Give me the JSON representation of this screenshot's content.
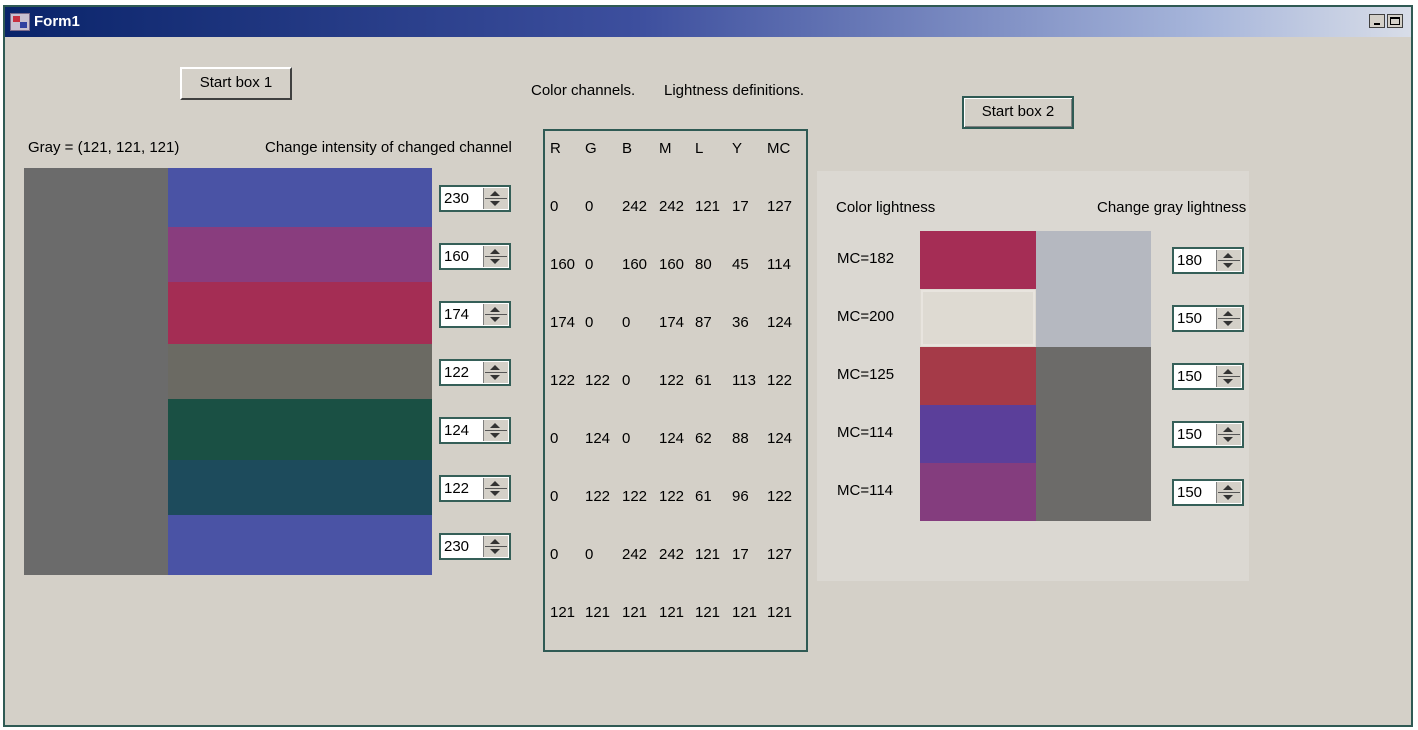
{
  "window": {
    "title": "Form1",
    "controls": {
      "minimize": "minimize-icon",
      "maximize": "maximize-icon"
    }
  },
  "left": {
    "start_button": "Start box 1",
    "gray_label": "Gray = (121, 121, 121)",
    "change_label": "Change intensity of changed channel",
    "gray_color": "#6b6b6b",
    "swatches": [
      {
        "color": "#4a53a5",
        "value": "230"
      },
      {
        "color": "#893d7e",
        "value": "160"
      },
      {
        "color": "#a42d54",
        "value": "174"
      },
      {
        "color": "#6b6a63",
        "value": "122"
      },
      {
        "color": "#1a5044",
        "value": "124"
      },
      {
        "color": "#1d4b5c",
        "value": "122"
      },
      {
        "color": "#4a53a5",
        "value": "230"
      }
    ]
  },
  "middle": {
    "channels_label": "Color channels.",
    "lightness_label": "Lightness definitions.",
    "headers": [
      "R",
      "G",
      "B",
      "M",
      "L",
      "Y",
      "MC"
    ],
    "rows": [
      [
        "0",
        "0",
        "242",
        "242",
        "121",
        "17",
        "127"
      ],
      [
        "160",
        "0",
        "160",
        "160",
        "80",
        "45",
        "114"
      ],
      [
        "174",
        "0",
        "0",
        "174",
        "87",
        "36",
        "124"
      ],
      [
        "122",
        "122",
        "0",
        "122",
        "61",
        "113",
        "122"
      ],
      [
        "0",
        "124",
        "0",
        "124",
        "62",
        "88",
        "124"
      ],
      [
        "0",
        "122",
        "122",
        "122",
        "61",
        "96",
        "122"
      ],
      [
        "0",
        "0",
        "242",
        "242",
        "121",
        "17",
        "127"
      ],
      [
        "121",
        "121",
        "121",
        "121",
        "121",
        "121",
        "121"
      ]
    ]
  },
  "right": {
    "start_button": "Start box 2",
    "color_lightness_label": "Color lightness",
    "gray_lightness_label": "Change gray lightness",
    "rows": [
      {
        "label": "MC=182",
        "color": "#a52d55",
        "gray": "#b5b8c0",
        "value": "180"
      },
      {
        "label": "MC=200",
        "color": "#dedad2",
        "gray": "#b5b8c0",
        "value": "150"
      },
      {
        "label": "MC=125",
        "color": "#a53a48",
        "gray": "#6c6b69",
        "value": "150"
      },
      {
        "label": "MC=114",
        "color": "#5b3f9a",
        "gray": "#6c6b69",
        "value": "150"
      },
      {
        "label": "MC=114",
        "color": "#843d7e",
        "gray": "#6c6b69",
        "value": "150"
      }
    ]
  }
}
